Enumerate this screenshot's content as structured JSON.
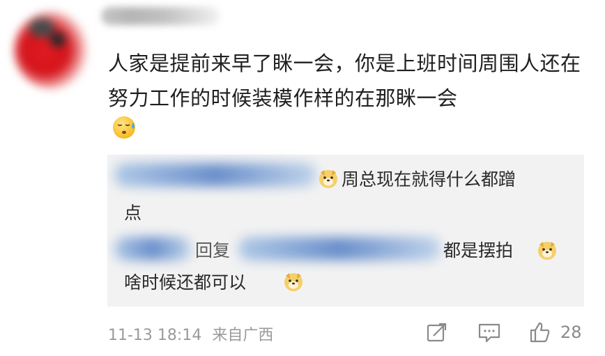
{
  "comment": {
    "text": "人家是提前来早了眯一会，你是上班时间周围人还在努力工作的时候装模作样的在那眯一会",
    "emoji_icon": "sweat-face-icon"
  },
  "replies": [
    {
      "text_line1": "周总现在就得什么都蹭",
      "text_line2": "点",
      "emoji_icon": "doge-icon"
    },
    {
      "prefix": "回复",
      "text_line1": "都是摆拍",
      "text_line2": "啥时候还都可以",
      "emoji_icon": "doge-icon"
    }
  ],
  "footer": {
    "timestamp": "11-13 18:14",
    "location": "来自广西",
    "like_count": "28",
    "icons": [
      "share-icon",
      "comment-icon",
      "like-icon"
    ]
  },
  "colors": {
    "reply_background": "#f2f2f2",
    "meta_text": "#9a9a9a",
    "body_text": "#1f1f1f"
  }
}
